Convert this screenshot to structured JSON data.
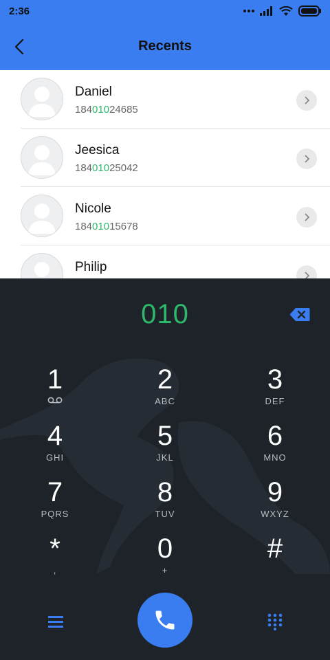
{
  "status_bar": {
    "time": "2:36",
    "icons": [
      "dots-icon",
      "signal-icon",
      "wifi-icon",
      "battery-icon"
    ]
  },
  "header": {
    "title": "Recents",
    "back_icon": "chevron-left-icon"
  },
  "contacts": [
    {
      "name": "Daniel",
      "number_prefix": "184",
      "number_match": "010",
      "number_suffix": "24685"
    },
    {
      "name": "Jeesica",
      "number_prefix": "184",
      "number_match": "010",
      "number_suffix": "25042"
    },
    {
      "name": "Nicole",
      "number_prefix": "184",
      "number_match": "010",
      "number_suffix": "15678"
    },
    {
      "name": "Philip",
      "number_prefix": "",
      "number_match": "",
      "number_suffix": ""
    }
  ],
  "dialer": {
    "input": "010",
    "keys": [
      {
        "digit": "1",
        "letters": ""
      },
      {
        "digit": "2",
        "letters": "ABC"
      },
      {
        "digit": "3",
        "letters": "DEF"
      },
      {
        "digit": "4",
        "letters": "GHI"
      },
      {
        "digit": "5",
        "letters": "JKL"
      },
      {
        "digit": "6",
        "letters": "MNO"
      },
      {
        "digit": "7",
        "letters": "PQRS"
      },
      {
        "digit": "8",
        "letters": "TUV"
      },
      {
        "digit": "9",
        "letters": "WXYZ"
      },
      {
        "digit": "*",
        "letters": ","
      },
      {
        "digit": "0",
        "letters": "+"
      },
      {
        "digit": "#",
        "letters": ""
      }
    ]
  },
  "colors": {
    "accent": "#3a7df0",
    "match": "#2eb86b",
    "dialer_bg": "#1e2329"
  }
}
